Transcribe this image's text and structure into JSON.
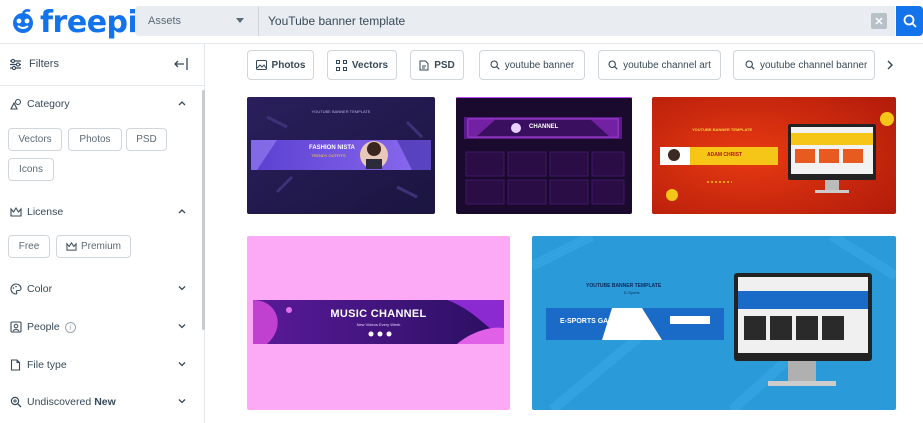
{
  "header": {
    "logo_text": "freepik",
    "asset_select": "Assets",
    "search_value": "YouTube banner template",
    "clear_icon": "close-icon",
    "search_icon": "search-icon"
  },
  "sidebar": {
    "title": "Filters",
    "category": {
      "label": "Category",
      "options": [
        "Vectors",
        "Photos",
        "PSD",
        "Icons"
      ]
    },
    "license": {
      "label": "License",
      "options": [
        "Free",
        "Premium"
      ]
    },
    "color_label": "Color",
    "people_label": "People",
    "people_info": "i",
    "filetype_label": "File type",
    "undiscovered_label": "Undiscovered",
    "undiscovered_badge": "New"
  },
  "tags": [
    {
      "label": "Photos",
      "icon": "image-icon"
    },
    {
      "label": "Vectors",
      "icon": "vector-icon"
    },
    {
      "label": "PSD",
      "icon": "file-icon"
    },
    {
      "label": "youtube banner",
      "icon": "search-icon"
    },
    {
      "label": "youtube channel art",
      "icon": "search-icon"
    },
    {
      "label": "youtube channel banner",
      "icon": "search-icon"
    }
  ],
  "results": [
    {
      "heading": "YOUTUBE BANNER TEMPLATE",
      "title": "FASHION NISTA",
      "subtitle": "TRENDY OUTFITS"
    },
    {
      "heading": "",
      "title": "CHANNEL",
      "subtitle": ""
    },
    {
      "heading": "YOUTUBE BANNER TEMPLATE",
      "title": "ADAM CHRIST",
      "subtitle": ""
    },
    {
      "heading": "",
      "title": "MUSIC CHANNEL",
      "subtitle": "New Videos Every Week"
    },
    {
      "heading": "YOUTUBE BANNER TEMPLATE",
      "title": "E-SPORTS GAME",
      "subtitle": "E-Sports"
    }
  ],
  "colors": {
    "brand": "#1273eb",
    "new": "#35b96b"
  }
}
